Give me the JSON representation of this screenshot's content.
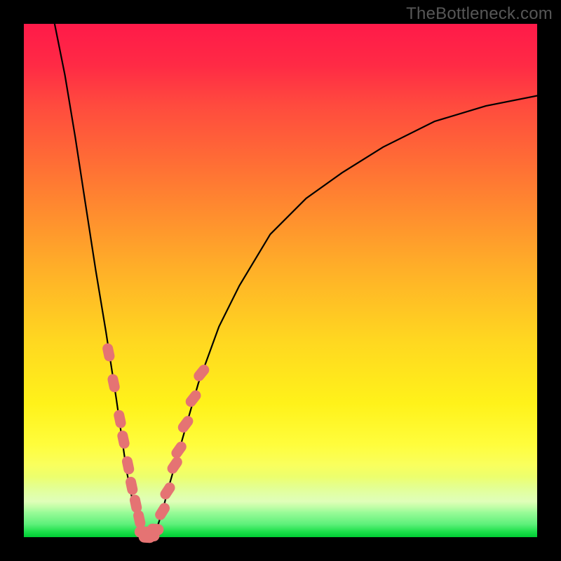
{
  "watermark": "TheBottleneck.com",
  "colors": {
    "frame": "#000000",
    "curve": "#000000",
    "marker": "#e57373",
    "gradient_top": "#ff1a49",
    "gradient_bottom": "#00cc33"
  },
  "chart_data": {
    "type": "line",
    "title": "",
    "xlabel": "",
    "ylabel": "",
    "xlim": [
      0,
      100
    ],
    "ylim": [
      0,
      100
    ],
    "notes": "Bottleneck-percentage style V-curve; minimum (0% bottleneck) near x≈24. Background is a vertical red→orange→yellow→green heat gradient with green at y=0. Salmon markers cluster near the trough on both arms.",
    "series": [
      {
        "name": "bottleneck_curve",
        "x": [
          6,
          8,
          10,
          12,
          14,
          16,
          18,
          20,
          21,
          22,
          23,
          24,
          25,
          26,
          27,
          28,
          30,
          32,
          34,
          38,
          42,
          48,
          55,
          62,
          70,
          80,
          90,
          100
        ],
        "y": [
          100,
          90,
          78,
          65,
          52,
          40,
          27,
          13,
          8,
          4,
          1,
          0,
          0.5,
          2,
          5,
          9,
          16,
          23,
          30,
          41,
          49,
          59,
          66,
          71,
          76,
          81,
          84,
          86
        ]
      }
    ],
    "markers": {
      "left_arm": [
        {
          "x": 16.5,
          "y": 36
        },
        {
          "x": 17.5,
          "y": 30
        },
        {
          "x": 18.7,
          "y": 23
        },
        {
          "x": 19.4,
          "y": 19
        },
        {
          "x": 20.3,
          "y": 14
        },
        {
          "x": 21,
          "y": 10
        },
        {
          "x": 21.8,
          "y": 6.5
        },
        {
          "x": 22.5,
          "y": 3.5
        }
      ],
      "trough": [
        {
          "x": 23.2,
          "y": 1
        },
        {
          "x": 24,
          "y": 0
        },
        {
          "x": 24.8,
          "y": 0.3
        },
        {
          "x": 25.6,
          "y": 1.5
        }
      ],
      "right_arm": [
        {
          "x": 27,
          "y": 5
        },
        {
          "x": 28,
          "y": 9
        },
        {
          "x": 29.4,
          "y": 14
        },
        {
          "x": 30.2,
          "y": 17
        },
        {
          "x": 31.5,
          "y": 22
        },
        {
          "x": 33,
          "y": 27
        },
        {
          "x": 34.6,
          "y": 32
        }
      ]
    }
  }
}
